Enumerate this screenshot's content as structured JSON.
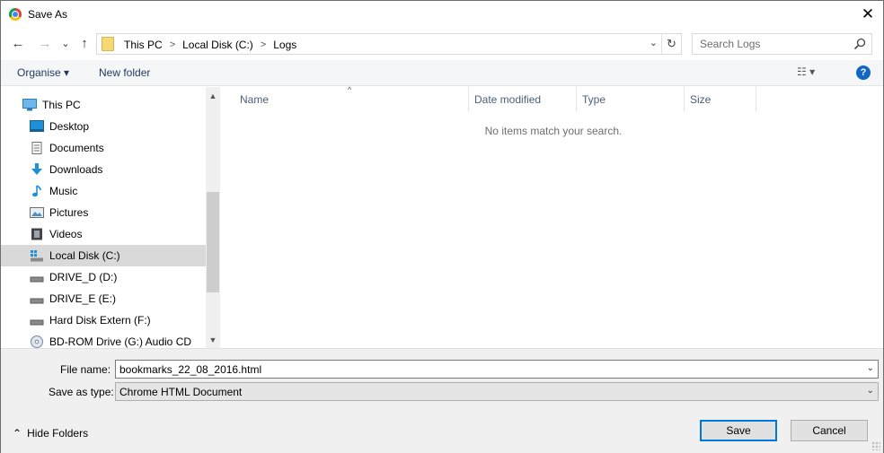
{
  "window": {
    "title": "Save As",
    "close_glyph": "✕",
    "app_icon": "chrome-icon"
  },
  "nav": {
    "back_glyph": "←",
    "forward_glyph": "→",
    "recent_glyph": "⌄",
    "up_glyph": "↑",
    "breadcrumb": [
      "This PC",
      "Local Disk (C:)",
      "Logs"
    ],
    "breadcrumb_sep": ">",
    "dropdown_glyph": "⌄",
    "refresh_glyph": "↻",
    "search_placeholder": "Search Logs"
  },
  "toolbar": {
    "organise_label": "Organise ▾",
    "new_folder_label": "New folder",
    "view_glyph": "☷ ▾",
    "help_glyph": "?"
  },
  "sidebar": {
    "items": [
      {
        "label": "This PC",
        "icon": "computer-icon",
        "selected": false,
        "indent": 1
      },
      {
        "label": "Desktop",
        "icon": "desktop-icon",
        "selected": false,
        "indent": 2
      },
      {
        "label": "Documents",
        "icon": "documents-icon",
        "selected": false,
        "indent": 2
      },
      {
        "label": "Downloads",
        "icon": "downloads-icon",
        "selected": false,
        "indent": 2
      },
      {
        "label": "Music",
        "icon": "music-icon",
        "selected": false,
        "indent": 2
      },
      {
        "label": "Pictures",
        "icon": "pictures-icon",
        "selected": false,
        "indent": 2
      },
      {
        "label": "Videos",
        "icon": "videos-icon",
        "selected": false,
        "indent": 2
      },
      {
        "label": "Local Disk (C:)",
        "icon": "system-drive-icon",
        "selected": true,
        "indent": 2
      },
      {
        "label": "DRIVE_D (D:)",
        "icon": "drive-icon",
        "selected": false,
        "indent": 2
      },
      {
        "label": "DRIVE_E (E:)",
        "icon": "drive-icon",
        "selected": false,
        "indent": 2
      },
      {
        "label": "Hard Disk Extern (F:)",
        "icon": "drive-icon",
        "selected": false,
        "indent": 2
      },
      {
        "label": "BD-ROM Drive (G:) Audio CD",
        "icon": "cd-drive-icon",
        "selected": false,
        "indent": 2
      }
    ],
    "scroll_up_glyph": "▲",
    "scroll_down_glyph": "▼"
  },
  "filelist": {
    "columns": [
      "Name",
      "Date modified",
      "Type",
      "Size"
    ],
    "sort_glyph": "^",
    "empty_message": "No items match your search."
  },
  "form": {
    "filename_label": "File name:",
    "filename_value": "bookmarks_22_08_2016.html",
    "filetype_label": "Save as type:",
    "filetype_value": "Chrome HTML Document",
    "caret_glyph": "⌄"
  },
  "footer": {
    "hide_folders_glyph": "⌃",
    "hide_folders_label": "Hide Folders",
    "save_label": "Save",
    "cancel_label": "Cancel"
  },
  "colors": {
    "accent": "#0078d7",
    "help": "#1366c5",
    "selected_row": "#d9d9d9",
    "column_header_text": "#4c607a"
  }
}
